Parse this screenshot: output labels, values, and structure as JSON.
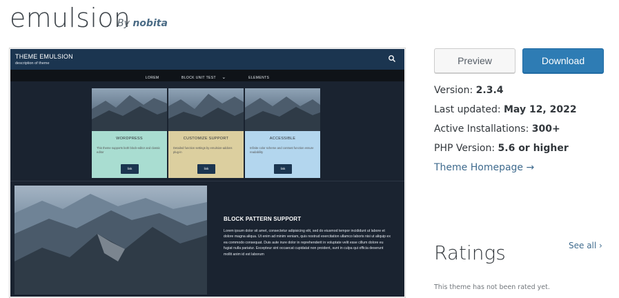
{
  "theme": {
    "name": "emulsion",
    "by_label": "By",
    "author": "nobita"
  },
  "screenshot": {
    "site_title": "THEME EMULSION",
    "site_description": "description of theme",
    "nav": [
      "LOREM",
      "BLOCK UNIT TEST",
      "ELEMENTS"
    ],
    "cards": [
      {
        "title": "WORDPRESS",
        "text": "This theme supports both block-editor and classic editor",
        "button": "link"
      },
      {
        "title": "CUSTOMIZE SUPPORT",
        "text": "Detailed function settings by emulsion-addons plug-in",
        "button": "link"
      },
      {
        "title": "ACCESSIBLE",
        "text": "Infinite color scheme and contrast function ensure readability",
        "button": "link"
      }
    ],
    "pattern_title": "BLOCK PATTERN SUPPORT",
    "pattern_text": "Lorem ipsum dolor sit amet, consectetur adipisicing elit, sed do eiusmod tempor incididunt ut labore et dolore magna aliqua. Ut enim ad minim veniam, quis nostrud exercitation ullamco laboris nisi ut aliquip ex ea commodo consequat. Duis aute irure dolor in reprehenderit in voluptate velit esse cillum dolore eu fugiat nulla pariatur. Excepteur sint occaecat cupidatat non proident, sunt in culpa qui officia deserunt mollit anim id est laborum"
  },
  "actions": {
    "preview": "Preview",
    "download": "Download"
  },
  "meta": {
    "version_label": "Version:",
    "version": "2.3.4",
    "updated_label": "Last updated:",
    "updated": "May 12, 2022",
    "installs_label": "Active Installations:",
    "installs": "300+",
    "php_label": "PHP Version:",
    "php": "5.6 or higher",
    "homepage": "Theme Homepage →"
  },
  "ratings": {
    "title": "Ratings",
    "see_all": "See all ›",
    "empty": "This theme has not been rated yet."
  },
  "colors": {
    "accent": "#2e7cb4",
    "link": "#3f6b8e",
    "header": "#1b3550"
  }
}
